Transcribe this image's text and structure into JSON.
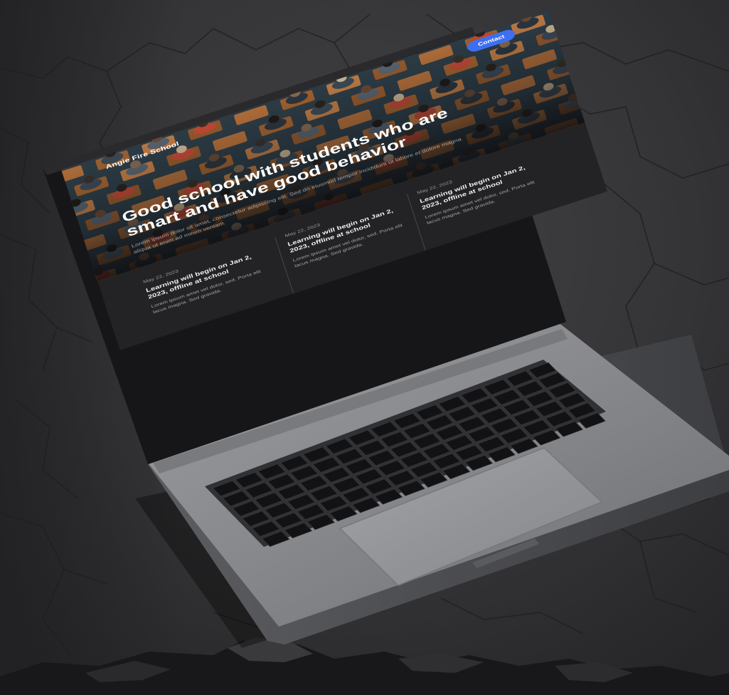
{
  "site": {
    "logo_text": "Angie Fire School",
    "contact_label": "Contact"
  },
  "hero": {
    "title": "Good school with students who are smart and have good behavior",
    "subtitle": "Lorem ipsum dolor sit amet, consectetur adipiscing elit. Sed do eiusmod tempor incididunt ut labore et dolore magna aliqua ut enim ad minim veniam."
  },
  "news": [
    {
      "date": "May 22, 2023",
      "title": "Learning will begin on Jan 2, 2023, offline at school",
      "body": "Lorem ipsum amet vel dolor, sed. Porta elit lacus magna. Sed gravida."
    },
    {
      "date": "May 22, 2023",
      "title": "Learning will begin on Jan 2, 2023, offline at school",
      "body": "Lorem ipsum amet vel dolor, sed. Porta elit lacus magna. Sed gravida."
    },
    {
      "date": "May 22, 2023",
      "title": "Learning will begin on Jan 2, 2023, offline at school",
      "body": "Lorem ipsum amet vel dolor, sed. Porta elit lacus magna. Sed gravida."
    }
  ],
  "colors": {
    "accent": "#3e6ff0",
    "background": "#2f2f31",
    "laptop_body": "#8e8f93",
    "screen_bg": "#232325"
  }
}
